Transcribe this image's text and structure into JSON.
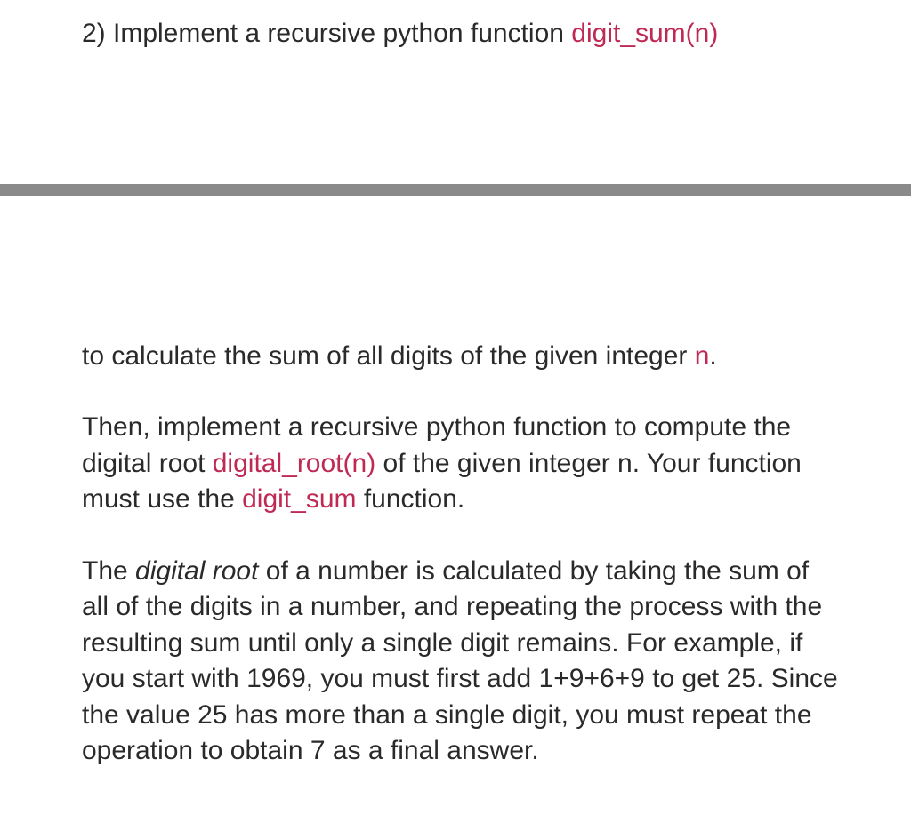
{
  "top": {
    "line1_prefix": "2) Implement a recursive python function ",
    "line1_code": "digit_sum(n)"
  },
  "bottom": {
    "p1_prefix": "to calculate the sum of all digits of the given integer ",
    "p1_code": "n",
    "p1_suffix": ".",
    "p2_part1": "Then, implement a recursive python function to compute the digital root ",
    "p2_code1": "digital_root(n)",
    "p2_part2": " of the given integer n. Your function must use the ",
    "p2_code2": "digit_sum",
    "p2_part3": " function.",
    "p3_part1": "The ",
    "p3_italic": "digital root",
    "p3_part2": " of a number is calculated by taking the sum of all of the digits in a number, and repeating the process with the resulting sum until only a single digit remains.   For example, if you start with 1969, you must first add 1+9+6+9 to get 25.   Since the value 25 has more than a single digit, you must repeat the operation to obtain 7 as a final answer."
  }
}
